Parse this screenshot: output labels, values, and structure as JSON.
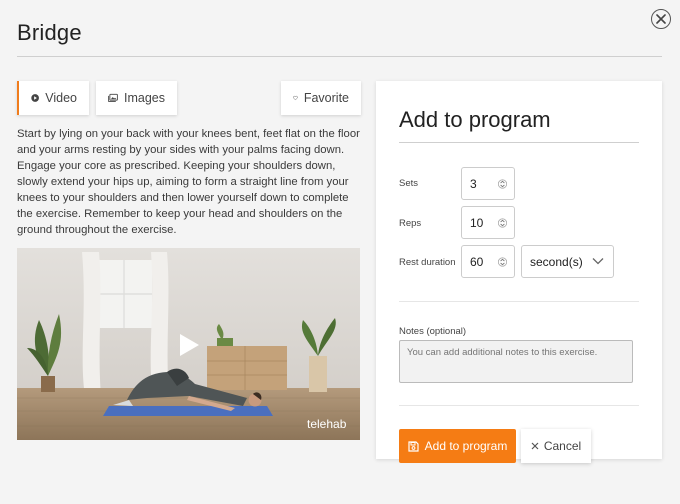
{
  "modal": {
    "title": "Bridge"
  },
  "tabs": {
    "video": "Video",
    "images": "Images",
    "favorite": "Favorite"
  },
  "description": "Start by lying on your back with your knees bent, feet flat on the floor and your arms resting by your sides with your palms facing down. Engage your core as prescribed. Keeping your shoulders down, slowly extend your hips up, aiming to form a straight line from your knees to your shoulders and then lower yourself down to complete the exercise. Remember to keep your head and shoulders on the ground throughout the exercise.",
  "video": {
    "watermark": "telehab"
  },
  "program": {
    "title": "Add to program",
    "sets_label": "Sets",
    "sets_value": "3",
    "reps_label": "Reps",
    "reps_value": "10",
    "rest_label": "Rest duration",
    "rest_value": "60",
    "rest_unit": "second(s)",
    "notes_label": "Notes (optional)",
    "notes_placeholder": "You can add additional notes to this exercise.",
    "add_button": "Add to program",
    "cancel_button": "Cancel"
  },
  "colors": {
    "accent": "#f57c14",
    "text": "#333333",
    "background": "#f4f4f4"
  },
  "icons": {
    "close": "close-icon",
    "video": "play-circle-icon",
    "images": "images-icon",
    "favorite": "heart-icon",
    "video_play": "play-icon",
    "stepper": "stepper-arrows-icon",
    "select": "chevron-down-icon",
    "save": "save-icon",
    "cancel": "x-icon"
  }
}
